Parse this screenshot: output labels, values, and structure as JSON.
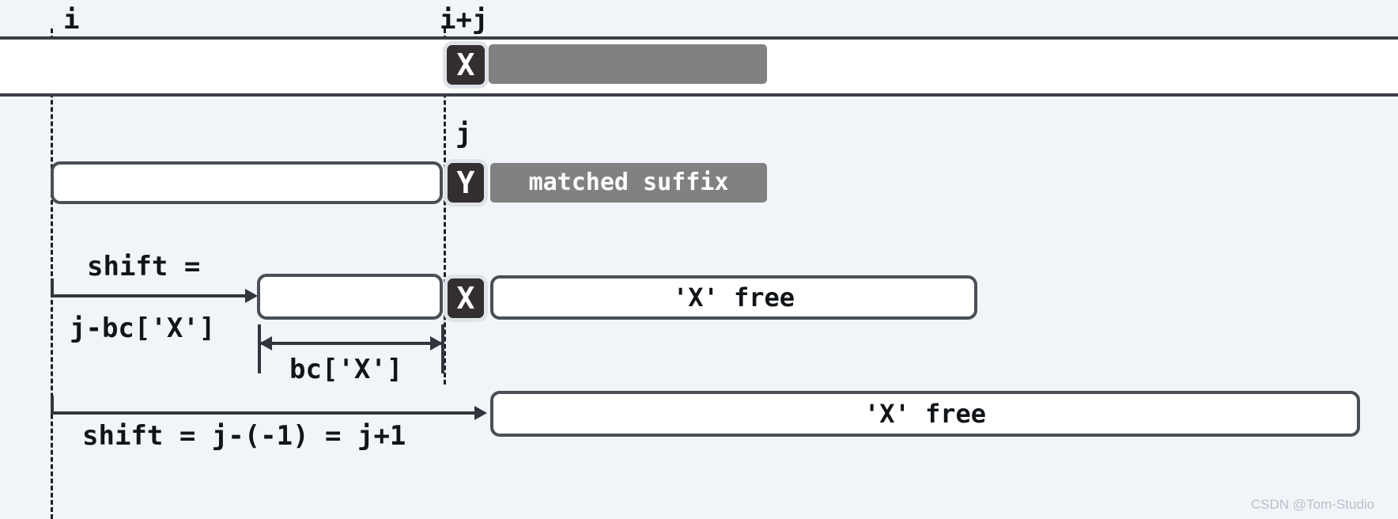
{
  "diagram": {
    "title": "Boyer-Moore bad character shift diagram",
    "background_color": "#f1f5f9",
    "accent_dark": "#332f30",
    "accent_gray": "#818181"
  },
  "markers": {
    "i": "i",
    "i_plus_j": "i+j",
    "j": "j"
  },
  "row_text": {
    "text_char": "X",
    "text_match_bar": ""
  },
  "row_pattern": {
    "pattern_char": "Y",
    "matched_suffix": "matched suffix"
  },
  "row_shift": {
    "shift_label_top": "shift =",
    "shift_label_bottom": "j-bc['X']",
    "pattern_char": "X",
    "x_free": "'X' free",
    "bc_measure_label": "bc['X']"
  },
  "row_nomatch": {
    "shift_label": "shift = j-(-1) = j+1",
    "x_free": "'X' free"
  },
  "watermark": {
    "text": "CSDN @Tom-Studio"
  }
}
